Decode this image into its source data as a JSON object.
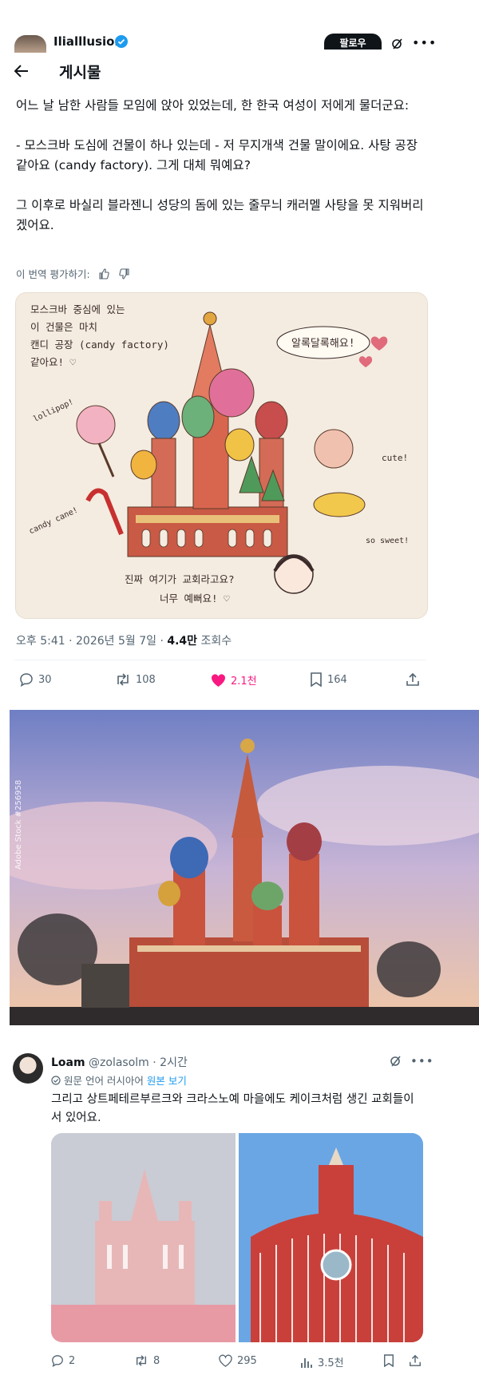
{
  "header": {
    "author_name": "Ilialllusion",
    "follow_label": "팔로우",
    "page_title": "게시물"
  },
  "post": {
    "text": "어느 날 남한 사람들 모임에 앉아 있었는데, 한 한국 여성이 저에게 물더군요:\n\n- 모스크바 도심에 건물이 하나 있는데 - 저 무지개색 건물 말이에요. 사탕 공장 같아요 (candy factory). 그게 대체 뭐예요?\n\n그 이후로 바실리 블라젠니 성당의 돔에 있는 줄무늬 캐러멜 사탕을 못 지워버리겠어요.",
    "rate_translation": "이 번역 평가하기:",
    "illustration": {
      "note_topleft": [
        "모스크바 중심에 있는",
        "이 건물은 마치",
        "캔디 공장 (candy factory)",
        "같아요! ♡"
      ],
      "bubble": "알록달록해요!",
      "lollipop": "lollipop!",
      "candy_cane": "candy cane!",
      "cute": "cute!",
      "so_sweet": "so sweet!",
      "bottom_line1": "진짜 여기가 교회라고요?",
      "bottom_line2": "너무 예뻐요! ♡"
    },
    "time": "오후 5:41",
    "date": "2026년 5월 7일",
    "views_count": "4.4만",
    "views_label": "조회수",
    "stats": {
      "replies": "30",
      "reposts": "108",
      "likes": "2.1천",
      "bookmarks": "164"
    }
  },
  "photo": {
    "watermark": "Adobe Stock",
    "stock_id": "#256958"
  },
  "reply": {
    "name": "Loam",
    "handle": "@zolasolm",
    "time": "2시간",
    "translated_from": "원문 언어 러시아어",
    "view_original": "원본 보기",
    "text": "그리고 상트페테르부르크와 크라스노예 마을에도 케이크처럼 생긴 교회들이 서 있어요.",
    "stats": {
      "replies": "2",
      "reposts": "8",
      "likes": "295",
      "views": "3.5천"
    }
  },
  "colors": {
    "like_pink": "#f91880",
    "link_blue": "#1d9bf0",
    "muted": "#536471"
  }
}
